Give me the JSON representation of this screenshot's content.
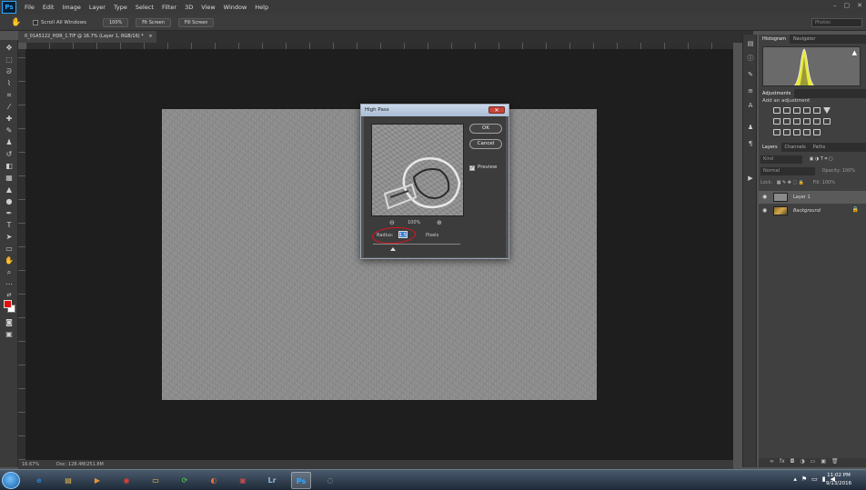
{
  "app": {
    "logo": "Ps",
    "menu": [
      "File",
      "Edit",
      "Image",
      "Layer",
      "Type",
      "Select",
      "Filter",
      "3D",
      "View",
      "Window",
      "Help"
    ],
    "window_controls": [
      "–",
      "▢",
      "✕"
    ]
  },
  "options_bar": {
    "scroll_all_windows": "Scroll All Windows",
    "zoom_button": "100%",
    "fit_screen": "Fit Screen",
    "fill_screen": "Fill Screen",
    "workspace": "Photos"
  },
  "document": {
    "tab_title": "0_01A5122_HDR_1.TIF @ 16.7% (Layer 1, RGB/16) *",
    "status_zoom": "16.67%",
    "status_doc": "Doc: 128.4M/251.8M"
  },
  "panels": {
    "histogram_tabs": [
      "Histogram",
      "Navigator"
    ],
    "adjustments_title": "Adjustments",
    "adjustments_hint": "Add an adjustment",
    "layers_tabs": [
      "Layers",
      "Channels",
      "Paths"
    ],
    "kind_filter": "Kind",
    "blend_mode": "Normal",
    "opacity_label": "Opacity: 100%",
    "lock_label": "Lock:",
    "fill_label": "Fill: 100%",
    "layers": [
      {
        "name": "Layer 1",
        "selected": true
      },
      {
        "name": "Background",
        "selected": false,
        "locked": true
      }
    ],
    "footer_icons": [
      "∞",
      "fx",
      "◘",
      "◑",
      "▭",
      "▣",
      "🗑"
    ]
  },
  "dialog": {
    "title": "High Pass",
    "close": "✕",
    "ok": "OK",
    "cancel": "Cancel",
    "preview_label": "Preview",
    "preview_checked": true,
    "zoom_percent": "100%",
    "radius_label": "Radius:",
    "radius_value": "1.5",
    "radius_unit": "Pixels",
    "slider_level": 0.23
  },
  "taskbar": {
    "time": "11:02 PM",
    "date": "9/13/2016",
    "apps": [
      {
        "name": "internet-explorer",
        "glyph": "e",
        "color": "#2a7fd4"
      },
      {
        "name": "file-explorer",
        "glyph": "▤",
        "color": "#e8b84a"
      },
      {
        "name": "media-player",
        "glyph": "▶",
        "color": "#e8943a"
      },
      {
        "name": "chrome",
        "glyph": "◉",
        "color": "#d9453a"
      },
      {
        "name": "sticky-notes",
        "glyph": "▭",
        "color": "#f0d24a"
      },
      {
        "name": "sync",
        "glyph": "⟳",
        "color": "#4ab84a"
      },
      {
        "name": "firefox",
        "glyph": "◐",
        "color": "#e8703a"
      },
      {
        "name": "app-8",
        "glyph": "▣",
        "color": "#c44a4a"
      },
      {
        "name": "lightroom",
        "glyph": "Lr",
        "color": "#8fb8d8"
      },
      {
        "name": "photoshop",
        "glyph": "Ps",
        "color": "#31a8ff"
      },
      {
        "name": "app-11",
        "glyph": "◌",
        "color": "#bbbbbb"
      }
    ]
  }
}
